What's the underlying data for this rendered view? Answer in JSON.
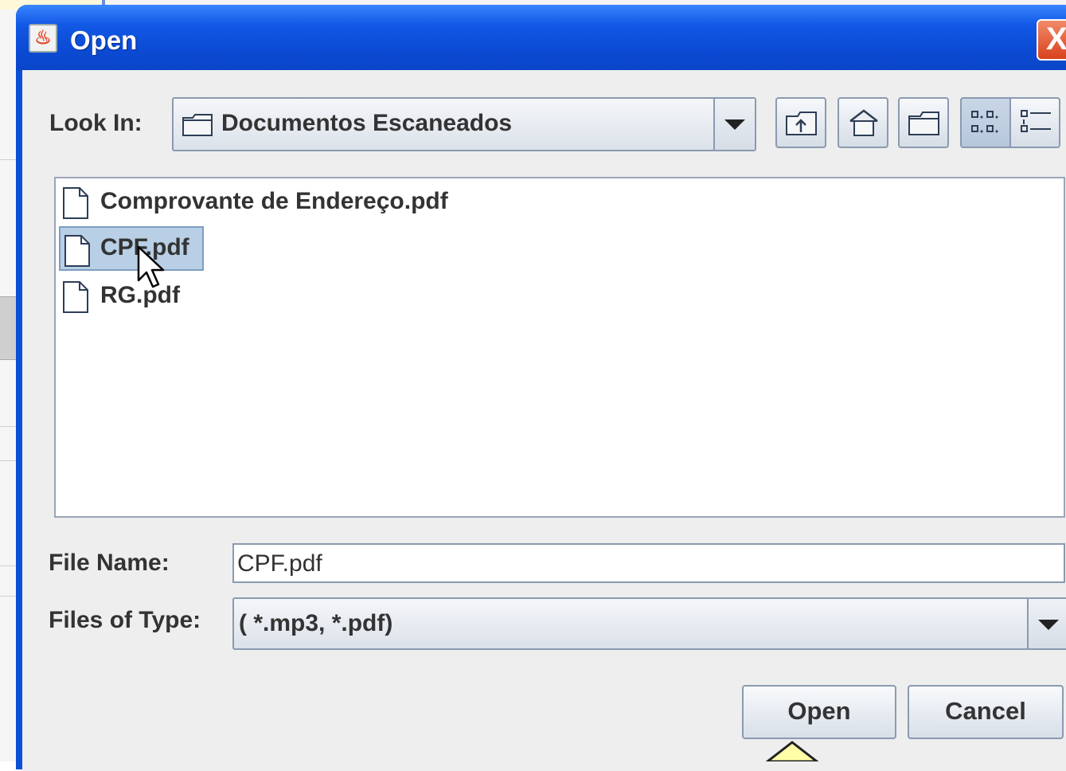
{
  "dialog": {
    "title": "Open",
    "close_label": "X"
  },
  "look_in": {
    "label": "Look In:",
    "selected": "Documentos Escaneados"
  },
  "toolbar": {
    "buttons": [
      "up-one-level",
      "home",
      "new-folder",
      "list-view",
      "details-view"
    ]
  },
  "files": [
    {
      "name": "Comprovante de Endereço.pdf",
      "selected": false
    },
    {
      "name": "CPF.pdf",
      "selected": true
    },
    {
      "name": "RG.pdf",
      "selected": false
    }
  ],
  "file_name": {
    "label": "File Name:",
    "value": "CPF.pdf"
  },
  "files_of_type": {
    "label": "Files of Type:",
    "value": "( *.mp3, *.pdf)"
  },
  "buttons": {
    "open": "Open",
    "cancel": "Cancel"
  },
  "colors": {
    "titlebar": "#0b4ad4",
    "selection": "#b8cfe5",
    "client_bg": "#eeeeee"
  }
}
